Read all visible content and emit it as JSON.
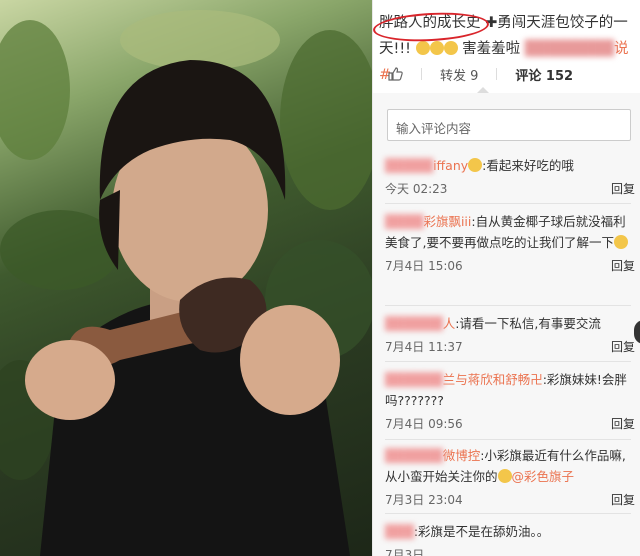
{
  "post": {
    "highlight": "胖路人的成长史",
    "text1": "勇闯天涯包饺子的一",
    "text2": "天!!!",
    "text3": "害羞羞啦",
    "handle_tail": "说#"
  },
  "actions": {
    "repost": "转发 9",
    "comment": "评论 152"
  },
  "comment_input": {
    "placeholder": "输入评论内容"
  },
  "comments": [
    {
      "name": "iffany",
      "text": ":看起来好吃的哦",
      "time": "今天 02:23",
      "reply": "回复"
    },
    {
      "name": "彩旗飘iii",
      "text": ":自从黄金椰子球后就没福利美食了,要不要再做点吃的让我们了解一下",
      "time": "7月4日 15:06",
      "reply": "回复"
    },
    {
      "name": "人",
      "text": ":请看一下私信,有事要交流",
      "time": "7月4日 11:37",
      "reply": "回复"
    },
    {
      "name": "兰与蒋欣和舒畅卍",
      "text": ":彩旗妹妹!会胖吗???????",
      "time": "7月4日 09:56",
      "reply": "回复"
    },
    {
      "name": "微博控",
      "text": ":小彩旗最近有什么作品嘛,从小蛮开始关注你的",
      "mention": "@彩色旗子",
      "time": "7月3日 23:04",
      "reply": "回复"
    },
    {
      "name": "",
      "text": ":彩旗是不是在舔奶油。。",
      "time": "7月3日",
      "reply": ""
    }
  ],
  "colors": {
    "accent": "#eb7350",
    "circle": "#d9252b"
  }
}
